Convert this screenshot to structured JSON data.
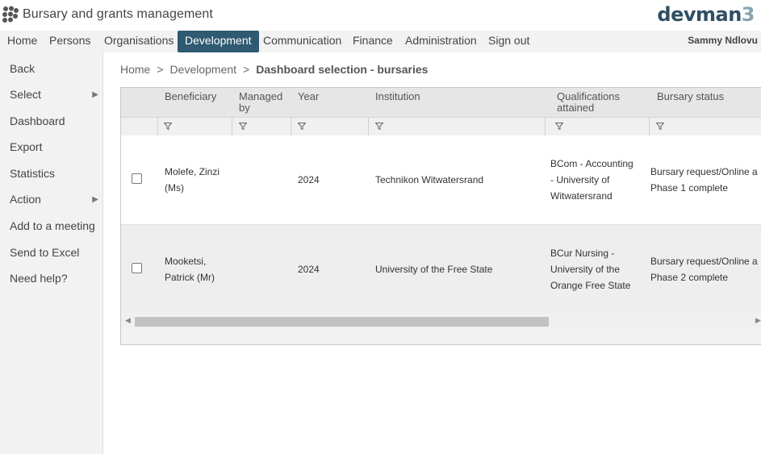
{
  "header": {
    "app_title": "Bursary and grants management",
    "brand_main": "devman",
    "brand_version": "3"
  },
  "nav": {
    "items": [
      "Home",
      "Persons",
      "Organisations",
      "Development",
      "Communication",
      "Finance",
      "Administration",
      "Sign out"
    ],
    "active": "Development",
    "user": "Sammy Ndlovu"
  },
  "sidebar": {
    "items": [
      "Back",
      "Select",
      "Dashboard",
      "Export",
      "Statistics",
      "Action",
      "Add to a meeting",
      "Send to Excel",
      "Need help?"
    ]
  },
  "breadcrumb": {
    "home": "Home",
    "section": "Development",
    "current": "Dashboard selection - bursaries"
  },
  "table": {
    "headers": {
      "beneficiary": "Beneficiary",
      "managed_by_1": "Managed",
      "managed_by_2": "by",
      "year": "Year",
      "institution": "Institution",
      "qualifications_1": "Qualifications",
      "qualifications_2": "attained",
      "status": "Bursary status"
    },
    "rows": [
      {
        "name_1": "Molefe, Zinzi",
        "name_2": "(Ms)",
        "year": "2024",
        "institution": "Technikon Witwatersrand",
        "qual_1": "BCom - Accounting",
        "qual_2": "- University of",
        "qual_3": "Witwatersrand",
        "status_1": "Bursary request/Online a",
        "status_2": "Phase 1 complete"
      },
      {
        "name_1": "Mooketsi,",
        "name_2": "Patrick (Mr)",
        "year": "2024",
        "institution": "University of the Free State",
        "qual_1": "BCur Nursing -",
        "qual_2": "University of the",
        "qual_3": "Orange Free State",
        "status_1": "Bursary request/Online a",
        "status_2": "Phase 2 complete"
      }
    ]
  },
  "icons": {
    "logo": "devman-logo-icon",
    "filter": "filter-icon",
    "submenu": "submenu-arrow-icon"
  },
  "colors": {
    "accent": "#2f5a71",
    "brand": "#2f4f62"
  }
}
